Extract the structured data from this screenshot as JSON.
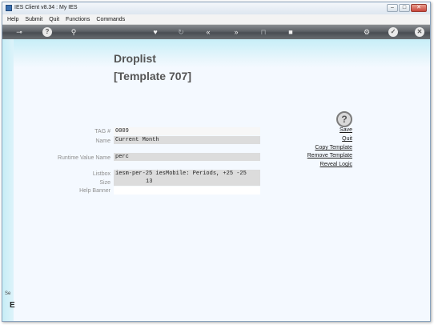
{
  "window": {
    "title": "IES Client v8.34 : My IES",
    "controls": [
      "–",
      "□",
      "✕"
    ]
  },
  "menu": {
    "items": [
      "Help",
      "Submit",
      "Quit",
      "Functions",
      "Commands"
    ]
  },
  "toolbar": {
    "icons": [
      "key-icon",
      "help-icon",
      "search-icon",
      "heart-icon",
      "refresh-icon",
      "rewind-icon",
      "forward-icon",
      "trash-icon",
      "stop-icon",
      "settings-icon",
      "check-icon",
      "close-icon"
    ],
    "glyphs": {
      "key": "⊸",
      "help": "?",
      "search": "⚲",
      "heart": "♥",
      "refresh": "↻",
      "rewind": "«",
      "forward": "»",
      "trash": "⊓",
      "stop": "■",
      "settings": "⚙",
      "check": "✓",
      "close": "✕"
    }
  },
  "page": {
    "heading": "Droplist",
    "subheading": "[Template 707]"
  },
  "form": {
    "tag_label": "TAG #",
    "tag_value": "0009",
    "name_label": "Name",
    "name_value": "Current Month",
    "runtime_label": "Runtime Value Name",
    "runtime_value": "perc",
    "listbox_label": "Listbox",
    "listbox_value": "iesm-per-25 iesMobile: Periods, +25 -25",
    "size_label": "Size",
    "size_value": "13",
    "help_banner_label": "Help Banner",
    "help_banner_value": ""
  },
  "actions": {
    "help_glyph": "?",
    "save": "Save",
    "quit": "Quit",
    "copy": "Copy Template",
    "remove": "Remove Template",
    "reveal": "Reveal Logic"
  },
  "sidebar": {
    "label_se": "Se",
    "label_e": "E"
  },
  "colors": {
    "banner": "#c7eef8",
    "content_bg": "#f4f9ff",
    "toolbar": "#5d6166",
    "heading": "#555555"
  }
}
